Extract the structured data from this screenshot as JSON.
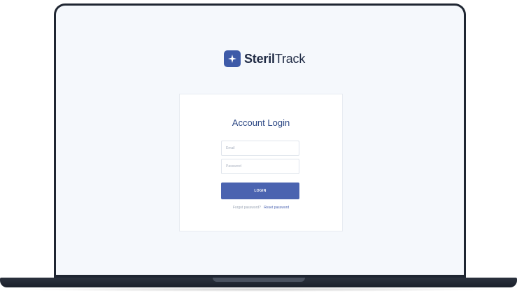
{
  "brand": {
    "name_bold": "Steril",
    "name_regular": "Track",
    "accent_color": "#3d5aa8",
    "logo_icon": "plus-sparkle-icon"
  },
  "login_card": {
    "title": "Account Login",
    "email": {
      "placeholder": "Email",
      "value": ""
    },
    "password": {
      "placeholder": "Password",
      "value": ""
    },
    "login_button_label": "LOGIN",
    "forgot_text": "Forgot password?",
    "reset_link_label": "Reset password"
  },
  "colors": {
    "button": "#4a63b0",
    "title": "#2f4a86",
    "screen_background": "#f5f8fc",
    "device_frame": "#1f2632"
  }
}
